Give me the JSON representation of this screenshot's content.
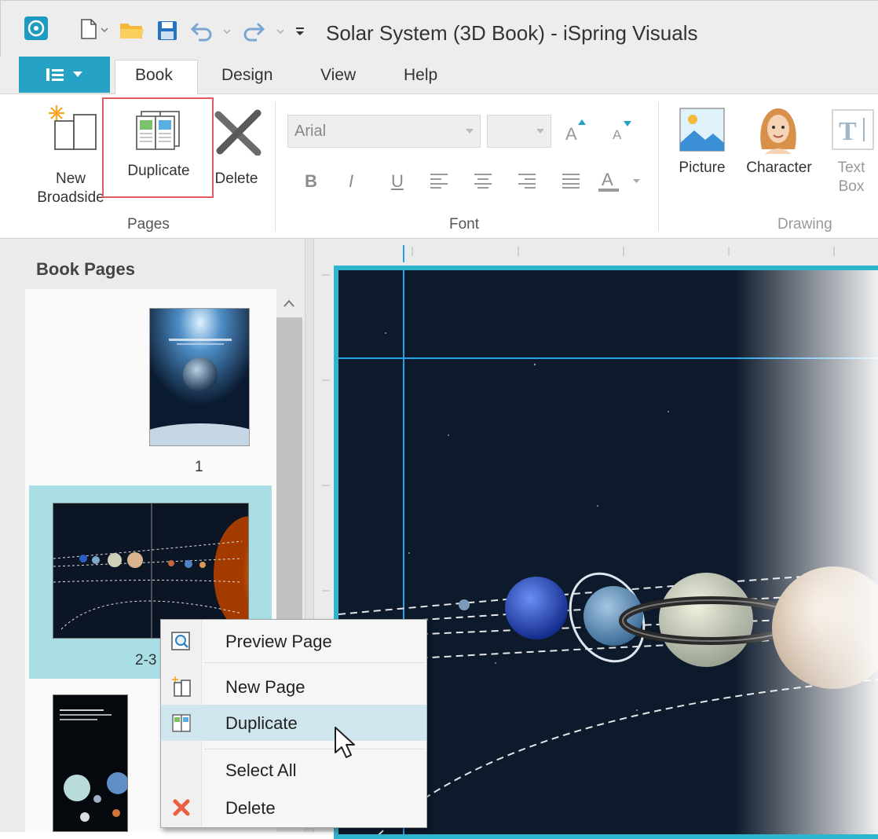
{
  "title_bar": {
    "title": "Solar System (3D Book) - iSpring Visuals",
    "quick_access_icons": [
      "app-logo-icon",
      "new-file-icon",
      "open-folder-icon",
      "save-icon",
      "undo-icon",
      "redo-icon",
      "customize-quick-access-icon"
    ]
  },
  "tabs": {
    "items": [
      "Book",
      "Design",
      "View",
      "Help"
    ],
    "active": "Book"
  },
  "ribbon": {
    "pages_group": {
      "label": "Pages",
      "new_broadside_line1": "New",
      "new_broadside_line2": "Broadside",
      "duplicate": "Duplicate",
      "delete": "Delete"
    },
    "font_group": {
      "label": "Font",
      "font_name": "Arial",
      "font_size": "",
      "bold": "B",
      "italic": "I",
      "underline": "U",
      "grow_font": "A",
      "shrink_font": "A",
      "font_color": "A"
    },
    "drawing_group": {
      "label": "Drawing",
      "picture": "Picture",
      "character": "Character",
      "text_box_line1": "Text",
      "text_box_line2": "Box"
    }
  },
  "book_pages": {
    "title": "Book Pages",
    "pages": [
      {
        "label": "1"
      },
      {
        "label": "2-3",
        "selected": true
      },
      {
        "label": ""
      }
    ]
  },
  "context_menu": {
    "items": [
      {
        "label": "Preview Page",
        "icon": "preview-page-icon"
      },
      {
        "label": "New Page",
        "icon": "new-page-icon"
      },
      {
        "label": "Duplicate",
        "icon": "duplicate-icon",
        "highlighted": true
      },
      {
        "label": "Select All",
        "icon": ""
      },
      {
        "label": "Delete",
        "icon": "delete-x-icon"
      }
    ]
  },
  "colors": {
    "accent": "#26a2c7",
    "selection": "#a9dfe4",
    "menu_highlight": "#cfe6ee",
    "highlight_box": "#e05a66",
    "delete_icon": "#e8603f"
  }
}
